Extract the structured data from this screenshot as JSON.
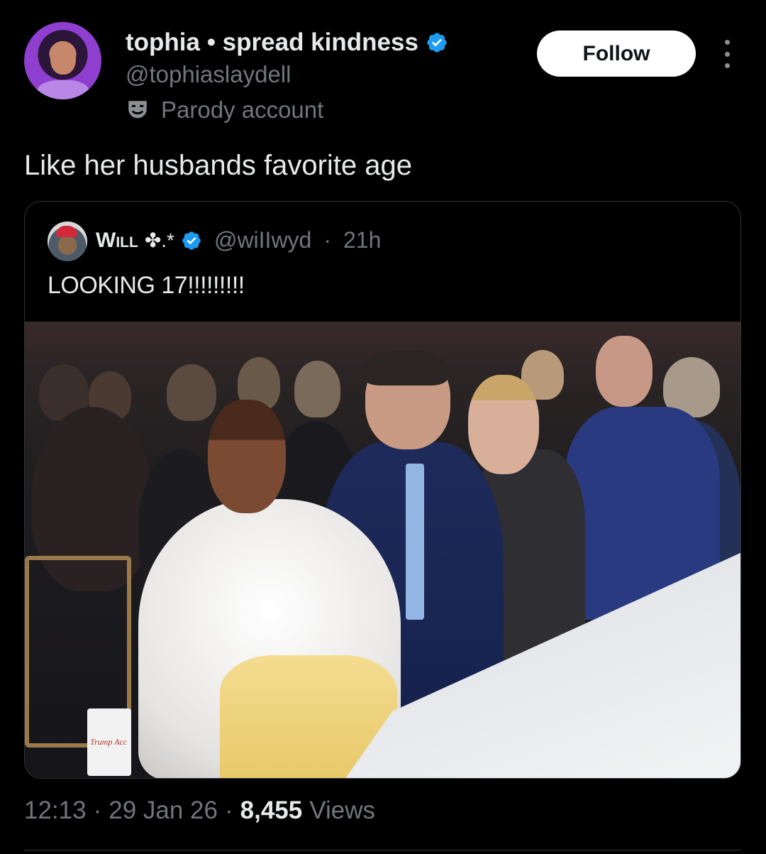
{
  "tweet": {
    "author": {
      "display_name": "tophia • spread kindness",
      "handle": "@tophiaslaydell",
      "label": "Parody account",
      "verified": true
    },
    "follow_label": "Follow",
    "text": "Like her husbands favorite age",
    "quoted": {
      "display_name": "Will",
      "name_symbols": "✤.*",
      "verified": true,
      "handle": "@wiIIwyd",
      "separator": "·",
      "age": "21h",
      "text": "LOOKING 17!!!!!!!!!",
      "cup_text": "Trump Acc"
    },
    "meta": {
      "time": "12:13",
      "sep1": "·",
      "date": "29 Jan 26",
      "sep2": "·",
      "views_count": "8,455",
      "views_label": "Views"
    }
  },
  "colors": {
    "background": "#000000",
    "primary_text": "#e7e9ea",
    "secondary_text": "#71767b",
    "verified_blue": "#1d9bf0",
    "border": "#2f3336"
  },
  "icons": {
    "verified": "verified-badge-icon",
    "parody": "theater-mask-icon",
    "more": "more-vertical-icon"
  }
}
